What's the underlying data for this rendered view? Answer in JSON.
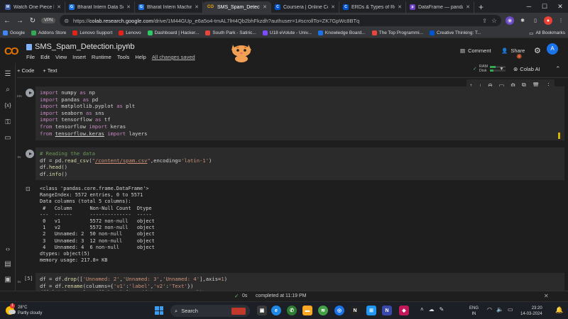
{
  "browser": {
    "tabs": [
      {
        "label": "Watch One Piece Eng",
        "fav_color": "#3a5ba0",
        "fav_char": "M"
      },
      {
        "label": "Bharat Intern Data Sc",
        "fav_color": "#1a73e8",
        "fav_char": "G"
      },
      {
        "label": "Bharat Intern Machin",
        "fav_color": "#1a73e8",
        "fav_char": "G"
      },
      {
        "label": "SMS_Spam_Detection",
        "fav_color": "#f9ab00",
        "fav_char": "CO",
        "active": true
      },
      {
        "label": "Coursera | Online Co",
        "fav_color": "#0056d2",
        "fav_char": "C"
      },
      {
        "label": "ERDs & Types of Rela",
        "fav_color": "#0056d2",
        "fav_char": "C"
      },
      {
        "label": "DataFrame — panda",
        "fav_color": "#6c3fc5",
        "fav_char": "p"
      }
    ],
    "url_prefix": "https://",
    "url_host": "colab.research.google.com",
    "url_path": "/drive/1M44GUp_e6a5o4-tmAL7lH4Qb2bhFkzdh?authuser=1#scrollTo=ZK7GpWc8BTq",
    "bookmarks": [
      {
        "label": "Google",
        "color": "#4285f4"
      },
      {
        "label": "Addons Store",
        "color": "#34a853"
      },
      {
        "label": "Lenovo Support",
        "color": "#e2231a"
      },
      {
        "label": "Lenovo",
        "color": "#e2231a"
      },
      {
        "label": "Dashboard | Hacker...",
        "color": "#2ec866"
      },
      {
        "label": "South Park - Satiric...",
        "color": "#e8453c"
      },
      {
        "label": "U18 eVolute - Univ...",
        "color": "#7c4dff"
      },
      {
        "label": "Knowledge Board...",
        "color": "#1a73e8"
      },
      {
        "label": "The Top Programmi...",
        "color": "#e8453c"
      },
      {
        "label": "Creative Thinking: T...",
        "color": "#0056d2"
      }
    ],
    "all_bookmarks": "All Bookmarks"
  },
  "colab": {
    "logo_text": "CO",
    "notebook_title": "SMS_Spam_Detection.ipynb",
    "menu": [
      "File",
      "Edit",
      "View",
      "Insert",
      "Runtime",
      "Tools",
      "Help"
    ],
    "saved_status": "All changes saved",
    "comment_label": "Comment",
    "share_label": "Share",
    "add_code_label": "+ Code",
    "add_text_label": "+ Text",
    "ram_label": "RAM",
    "disk_label": "Disk",
    "ram_usage_fraction": 0.35,
    "disk_usage_fraction": 0.22,
    "colab_ai_label": "Colab AI",
    "avatar_letter": "A"
  },
  "cells": [
    {
      "exec_time": "10s",
      "exec_count": ""
    },
    {
      "exec_time": "0s",
      "exec_count": ""
    },
    {
      "exec_time": "0s",
      "exec_count": "[5]"
    }
  ],
  "output_text": "<class 'pandas.core.frame.DataFrame'>\nRangeIndex: 5572 entries, 0 to 5571\nData columns (total 5 columns):\n #   Column      Non-Null Count  Dtype \n---  ------      --------------  ----- \n 0   v1          5572 non-null   object\n 1   v2          5572 non-null   object\n 2   Unnamed: 2  50 non-null     object\n 3   Unnamed: 3  12 non-null     object\n 4   Unnamed: 4  6 non-null      object\ndtypes: object(5)\nmemory usage: 217.8+ KB",
  "status": {
    "time": "0s",
    "message": "completed at 11:19 PM"
  },
  "taskbar": {
    "temperature": "28°C",
    "weather": "Partly cloudy",
    "search_label": "Search",
    "lang_line1": "ENG",
    "lang_line2": "IN",
    "time": "23:20",
    "date": "14-03-2024",
    "badge_count": "1"
  }
}
